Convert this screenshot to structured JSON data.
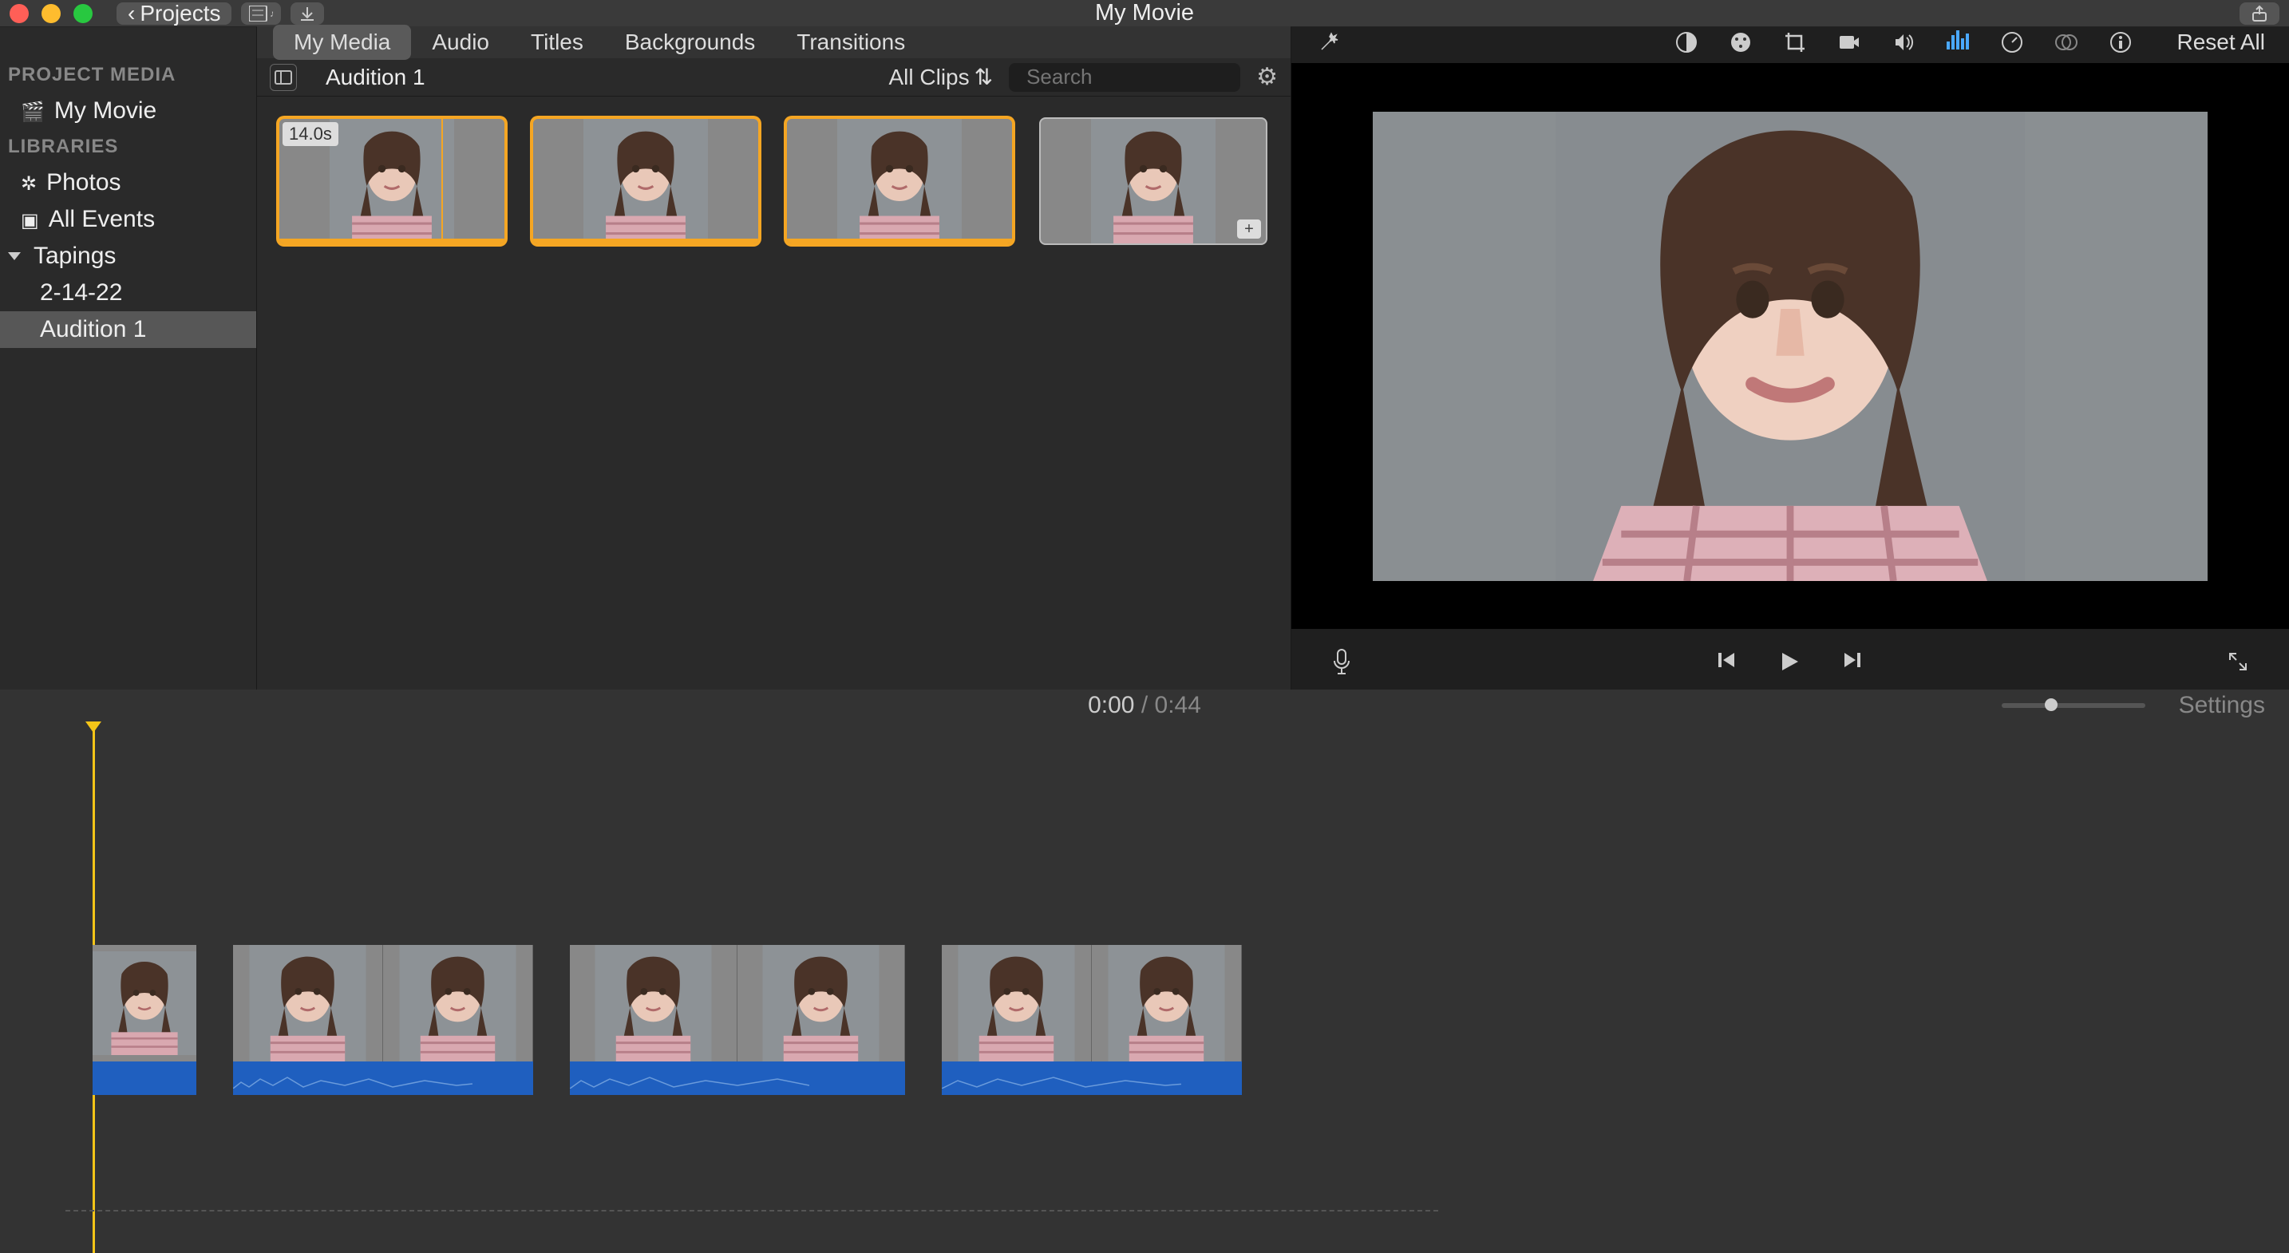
{
  "titlebar": {
    "projects_label": "Projects",
    "title": "My Movie",
    "chevron": "‹"
  },
  "sidebar": {
    "project_media_head": "PROJECT MEDIA",
    "my_movie": "My Movie",
    "libraries_head": "LIBRARIES",
    "photos": "Photos",
    "all_events": "All Events",
    "tapings": "Tapings",
    "date_event": "2-14-22",
    "audition": "Audition 1"
  },
  "tabs": {
    "my_media": "My Media",
    "audio": "Audio",
    "titles": "Titles",
    "backgrounds": "Backgrounds",
    "transitions": "Transitions"
  },
  "browser": {
    "location": "Audition 1",
    "filter_label": "All Clips",
    "search_placeholder": "Search",
    "clips": [
      {
        "duration": "14.0s",
        "selected": true,
        "has_playhead": true
      },
      {
        "duration": "",
        "selected": true
      },
      {
        "duration": "",
        "selected": true
      },
      {
        "duration": "",
        "selected": false,
        "has_plus": true
      }
    ]
  },
  "viewer": {
    "reset_label": "Reset All"
  },
  "timeline": {
    "current": "0:00",
    "sep": " / ",
    "total": "0:44",
    "settings_label": "Settings"
  }
}
